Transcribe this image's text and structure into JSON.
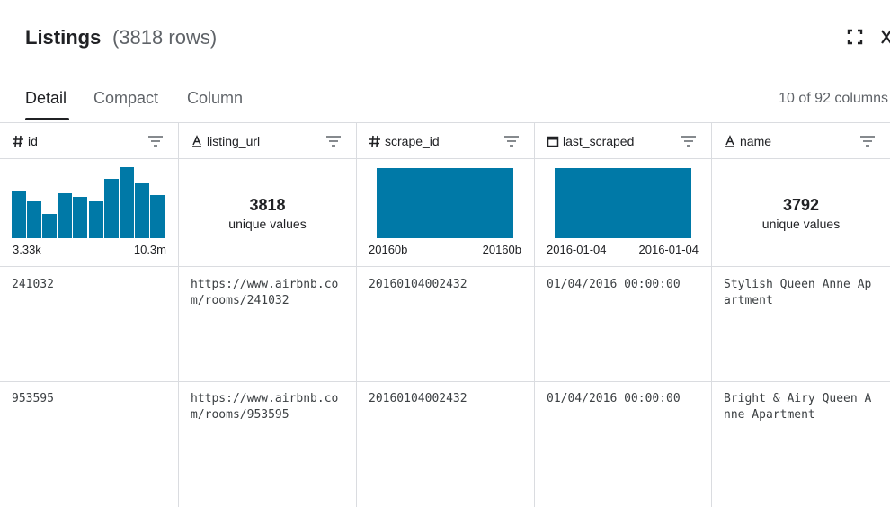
{
  "header": {
    "title": "Listings",
    "row_count": "(3818 rows)"
  },
  "tabs": [
    {
      "label": "Detail",
      "active": true
    },
    {
      "label": "Compact",
      "active": false
    },
    {
      "label": "Column",
      "active": false
    }
  ],
  "column_count": "10 of 92 columns",
  "accent_color": "#0079a7",
  "columns": [
    {
      "name": "id",
      "type_icon": "hash-icon",
      "summary": {
        "kind": "histogram",
        "bar_heights_fraction": [
          0.66,
          0.51,
          0.34,
          0.62,
          0.58,
          0.51,
          0.82,
          0.99,
          0.76,
          0.6
        ],
        "min_label": "3.33k",
        "max_label": "10.3m"
      }
    },
    {
      "name": "listing_url",
      "type_icon": "text-icon",
      "summary": {
        "kind": "unique",
        "count": "3818",
        "label": "unique values"
      }
    },
    {
      "name": "scrape_id",
      "type_icon": "hash-icon",
      "summary": {
        "kind": "single",
        "min_label": "20160b",
        "max_label": "20160b"
      }
    },
    {
      "name": "last_scraped",
      "type_icon": "calendar-icon",
      "summary": {
        "kind": "single",
        "min_label": "2016-01-04",
        "max_label": "2016-01-04"
      }
    },
    {
      "name": "name",
      "type_icon": "text-icon",
      "summary": {
        "kind": "unique",
        "count": "3792",
        "label": "unique values"
      }
    }
  ],
  "rows": [
    [
      "241032",
      "https://www.airbnb.com/rooms/241032",
      "20160104002432",
      "01/04/2016 00:00:00",
      "Stylish Queen Anne Apartment"
    ],
    [
      "953595",
      "https://www.airbnb.com/rooms/953595",
      "20160104002432",
      "01/04/2016 00:00:00",
      "Bright & Airy Queen Anne Apartment"
    ]
  ]
}
